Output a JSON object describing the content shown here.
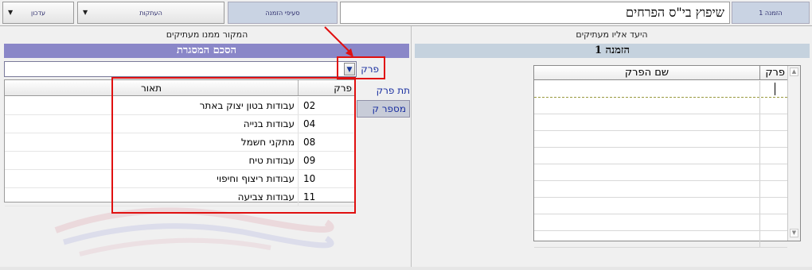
{
  "toolbar": {
    "update_label": "עדכון",
    "copies_label": "העתקות",
    "order_sections_label": "סעיפי הזמנה",
    "order_badge": "הזמנה 1"
  },
  "header": {
    "title": "שיפוץ בי\"ס הפרחים"
  },
  "left_panel": {
    "caption": "המקור ממנו מעתיקים",
    "band_title": "הסכם המסגרת",
    "section_label": "פרק",
    "sub_section_label": "תת פרק",
    "section_number_label": "מספר ק",
    "dropdown": {
      "columns": [
        "פרק",
        "תאור"
      ],
      "rows": [
        {
          "code": "02",
          "desc": "עבודות בטון יצוק באתר"
        },
        {
          "code": "04",
          "desc": "עבודות בנייה"
        },
        {
          "code": "08",
          "desc": "מתקני חשמל"
        },
        {
          "code": "09",
          "desc": "עבודות טיח"
        },
        {
          "code": "10",
          "desc": "עבודות ריצוף וחיפוי"
        },
        {
          "code": "11",
          "desc": "עבודות צביעה"
        }
      ]
    }
  },
  "right_panel": {
    "caption": "היעד אליו מעתיקים",
    "band_title": "הזמנה 1",
    "grid_columns": [
      "פרק",
      "שם הפרק"
    ]
  },
  "colors": {
    "left_band": "#8a87c8",
    "right_band": "#c5d2de",
    "highlight_red": "#e01010"
  },
  "icons": [
    "caret-down-icon",
    "scroll-up-icon",
    "scroll-down-icon"
  ]
}
